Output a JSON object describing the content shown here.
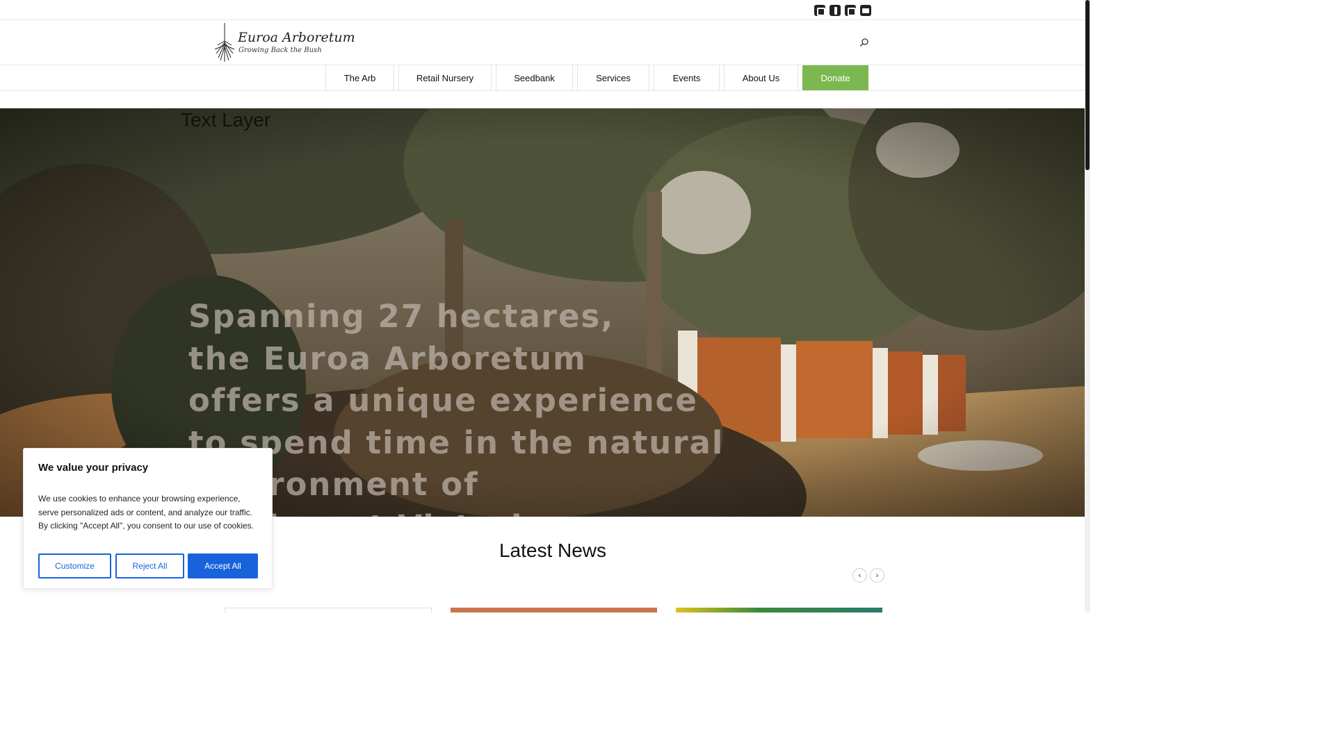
{
  "social": {
    "icons": [
      "instagram-icon",
      "facebook-icon",
      "flickr-icon",
      "youtube-icon"
    ]
  },
  "header": {
    "logo_title": "Euroa Arboretum",
    "logo_tagline": "Growing Back the Bush",
    "search_icon": "search-icon"
  },
  "nav": {
    "items": [
      {
        "label": "The Arb"
      },
      {
        "label": "Retail Nursery"
      },
      {
        "label": "Seedbank"
      },
      {
        "label": "Services"
      },
      {
        "label": "Events"
      },
      {
        "label": "About Us"
      },
      {
        "label": "Donate"
      }
    ],
    "donate_color": "#7bb850"
  },
  "hero": {
    "layer_label": "Text Layer",
    "lines": [
      "Spanning 27 hectares,",
      "the Euroa Arboretum",
      "offers a unique experience",
      "to spend time in the natural",
      "environment of",
      "north east Victoria."
    ]
  },
  "news": {
    "title": "Latest News",
    "prev": "‹",
    "next": "›"
  },
  "cookie": {
    "title": "We value your privacy",
    "body": "We use cookies to enhance your browsing experience, serve personalized ads or content, and analyze our traffic. By clicking \"Accept All\", you consent to our use of cookies.",
    "customize": "Customize",
    "reject": "Reject All",
    "accept": "Accept All",
    "accent": "#1863dc"
  }
}
